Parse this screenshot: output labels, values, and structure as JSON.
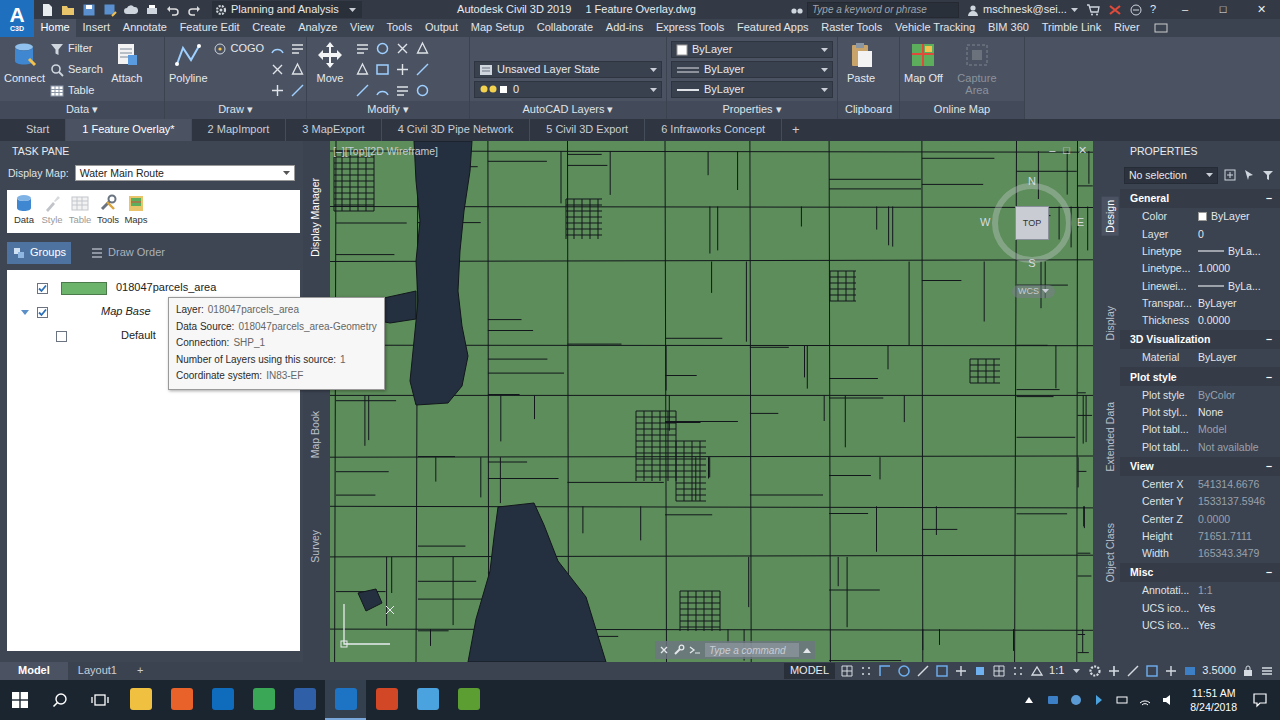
{
  "window": {
    "logo": "A",
    "logo_sub": "C3D",
    "workspace": "Planning and Analysis",
    "title": "Autodesk Civil 3D 2019",
    "file": "1 Feature Overlay.dwg",
    "search_placeholder": "Type a keyword or phrase",
    "user": "mschnesk@sei...",
    "help": "?",
    "controls": [
      "–",
      "□",
      "✕"
    ]
  },
  "ribbon_tabs": [
    {
      "label": "Home",
      "selected": true
    },
    {
      "label": "Insert",
      "selected": false
    },
    {
      "label": "Annotate",
      "selected": false
    },
    {
      "label": "Feature Edit",
      "selected": false
    },
    {
      "label": "Create",
      "selected": false
    },
    {
      "label": "Analyze",
      "selected": false
    },
    {
      "label": "View",
      "selected": false
    },
    {
      "label": "Tools",
      "selected": false
    },
    {
      "label": "Output",
      "selected": false
    },
    {
      "label": "Map Setup",
      "selected": false
    },
    {
      "label": "Collaborate",
      "selected": false
    },
    {
      "label": "Add-ins",
      "selected": false
    },
    {
      "label": "Express Tools",
      "selected": false
    },
    {
      "label": "Featured Apps",
      "selected": false
    },
    {
      "label": "Raster Tools",
      "selected": false
    },
    {
      "label": "Vehicle Tracking",
      "selected": false
    },
    {
      "label": "BIM 360",
      "selected": false
    },
    {
      "label": "Trimble Link",
      "selected": false
    },
    {
      "label": "River",
      "selected": false
    }
  ],
  "ribbon_groups": [
    {
      "title": "Data",
      "arrow": "▾",
      "items": [
        {
          "kind": "large",
          "label": "Connect",
          "disabled": false
        },
        {
          "kind": "small",
          "label": "Filter",
          "disabled": false
        },
        {
          "kind": "small",
          "label": "Search",
          "disabled": false
        },
        {
          "kind": "small",
          "label": "Table",
          "disabled": false
        },
        {
          "kind": "large",
          "label": "Attach",
          "disabled": false
        }
      ]
    },
    {
      "title": "Draw",
      "arrow": "▾",
      "items": [
        {
          "kind": "large",
          "label": "Polyline",
          "disabled": false
        },
        {
          "kind": "small",
          "label": "COGO",
          "disabled": false
        }
      ]
    },
    {
      "title": "Modify",
      "arrow": "▾",
      "items": [
        {
          "kind": "large",
          "label": "Move",
          "disabled": false
        }
      ]
    },
    {
      "title": "AutoCAD Layers",
      "arrow": "▾",
      "items": [
        {
          "kind": "dropdown",
          "label": "Unsaved Layer State",
          "disabled": false
        },
        {
          "kind": "dropdown",
          "label": "0",
          "disabled": false
        }
      ]
    },
    {
      "title": "Properties",
      "arrow": "▾",
      "items": [
        {
          "kind": "dropdown",
          "label": "ByLayer",
          "disabled": false
        },
        {
          "kind": "dropdown",
          "label": "ByLayer",
          "disabled": false
        },
        {
          "kind": "dropdown",
          "label": "ByLayer",
          "disabled": false
        }
      ]
    },
    {
      "title": "Clipboard",
      "items": [
        {
          "kind": "large",
          "label": "Paste",
          "disabled": false
        }
      ]
    },
    {
      "title": "Online Map",
      "items": [
        {
          "kind": "large",
          "label": "Map Off",
          "disabled": false
        },
        {
          "kind": "large",
          "label": "Capture Area",
          "disabled": true
        }
      ]
    }
  ],
  "doc_tabs": [
    {
      "label": "Start",
      "selected": false
    },
    {
      "label": "1 Feature Overlay*",
      "selected": true
    },
    {
      "label": "2 MapImport",
      "selected": false
    },
    {
      "label": "3 MapExport",
      "selected": false
    },
    {
      "label": "4 Civil 3D Pipe Network",
      "selected": false
    },
    {
      "label": "5 Civil 3D Export",
      "selected": false
    },
    {
      "label": "6 Infraworks Concept",
      "selected": false
    }
  ],
  "doc_tab_add": "+",
  "task_pane": {
    "title": "TASK PANE",
    "display_map_label": "Display Map:",
    "display_map": "Water Main Route",
    "tools": [
      {
        "label": "Data",
        "disabled": false
      },
      {
        "label": "Style",
        "disabled": true
      },
      {
        "label": "Table",
        "disabled": true
      },
      {
        "label": "Tools",
        "disabled": false
      },
      {
        "label": "Maps",
        "disabled": false
      }
    ],
    "views": [
      {
        "label": "Groups",
        "selected": true
      },
      {
        "label": "Draw Order",
        "selected": false
      }
    ],
    "layers": [
      {
        "kind": "layer",
        "label": "018047parcels_area",
        "checked": true,
        "color": "#6cb46c"
      },
      {
        "kind": "group",
        "label": "Map Base",
        "checked": true,
        "expanded": true
      },
      {
        "kind": "child",
        "label": "Default",
        "checked": false
      }
    ]
  },
  "task_side_tabs": [
    {
      "label": "Display Manager",
      "selected": true
    },
    {
      "label": "Map Book",
      "selected": false
    },
    {
      "label": "Survey",
      "selected": false
    }
  ],
  "tooltip": {
    "rows": [
      {
        "key": "Layer:",
        "value": "018047parcels_area"
      },
      {
        "key": "Data Source:",
        "value": "018047parcels_area-Geometry"
      },
      {
        "key": "Connection:",
        "value": "SHP_1"
      },
      {
        "key": "Number of Layers using this source:",
        "value": "1"
      },
      {
        "key": "Coordinate system:",
        "value": "IN83-EF"
      }
    ]
  },
  "viewport": {
    "label": "[–][Top][2D Wireframe]",
    "controls": [
      "–",
      "□",
      "✕"
    ],
    "compass": {
      "north": "N",
      "south": "S",
      "east": "E",
      "west": "W",
      "face": "TOP",
      "ucs": "WCS"
    },
    "command_placeholder": "Type a command"
  },
  "properties": {
    "title": "PROPERTIES",
    "selection": "No selection",
    "side_tabs": [
      {
        "label": "Design",
        "selected": true
      },
      {
        "label": "Display",
        "selected": false
      },
      {
        "label": "Extended Data",
        "selected": false
      },
      {
        "label": "Object Class",
        "selected": false
      }
    ],
    "sections": [
      {
        "title": "General",
        "toggle": "−",
        "expanded": true,
        "rows": [
          {
            "key": "Color",
            "value": "ByLayer",
            "kind": "swatch",
            "disabled": false
          },
          {
            "key": "Layer",
            "value": "0",
            "kind": "text",
            "disabled": false
          },
          {
            "key": "Linetype",
            "value": "ByLa...",
            "kind": "line",
            "disabled": false
          },
          {
            "key": "Linetype...",
            "value": "1.0000",
            "kind": "text",
            "disabled": false
          },
          {
            "key": "Linewei...",
            "value": "ByLa...",
            "kind": "line",
            "disabled": false
          },
          {
            "key": "Transpar...",
            "value": "ByLayer",
            "kind": "text",
            "disabled": false
          },
          {
            "key": "Thickness",
            "value": "0.0000",
            "kind": "text",
            "disabled": false
          }
        ]
      },
      {
        "title": "3D Visualization",
        "toggle": "−",
        "expanded": true,
        "rows": [
          {
            "key": "Material",
            "value": "ByLayer",
            "kind": "text",
            "disabled": false
          }
        ]
      },
      {
        "title": "Plot style",
        "toggle": "−",
        "expanded": true,
        "rows": [
          {
            "key": "Plot style",
            "value": "ByColor",
            "kind": "text",
            "disabled": true
          },
          {
            "key": "Plot styl...",
            "value": "None",
            "kind": "text",
            "disabled": false
          },
          {
            "key": "Plot tabl...",
            "value": "Model",
            "kind": "text",
            "disabled": true
          },
          {
            "key": "Plot tabl...",
            "value": "Not available",
            "kind": "text",
            "disabled": true
          }
        ]
      },
      {
        "title": "View",
        "toggle": "−",
        "expanded": true,
        "rows": [
          {
            "key": "Center X",
            "value": "541314.6676",
            "kind": "text",
            "disabled": true
          },
          {
            "key": "Center Y",
            "value": "1533137.5946",
            "kind": "text",
            "disabled": true
          },
          {
            "key": "Center Z",
            "value": "0.0000",
            "kind": "text",
            "disabled": true
          },
          {
            "key": "Height",
            "value": "71651.7111",
            "kind": "text",
            "disabled": true
          },
          {
            "key": "Width",
            "value": "165343.3479",
            "kind": "text",
            "disabled": true
          }
        ]
      },
      {
        "title": "Misc",
        "toggle": "−",
        "expanded": true,
        "rows": [
          {
            "key": "Annotati...",
            "value": "1:1",
            "kind": "text",
            "disabled": true
          },
          {
            "key": "UCS ico...",
            "value": "Yes",
            "kind": "text",
            "disabled": false
          },
          {
            "key": "UCS ico...",
            "value": "Yes",
            "kind": "text",
            "disabled": false
          }
        ]
      }
    ]
  },
  "layout_tabs": [
    {
      "label": "Model",
      "selected": true
    },
    {
      "label": "Layout1",
      "selected": false
    }
  ],
  "layout_add": "+",
  "status": {
    "model": "MODEL",
    "scale": "1:1",
    "annotation_scale": "3.5000"
  },
  "taskbar": {
    "apps": [
      {
        "color": "#f0c040",
        "selected": false
      },
      {
        "color": "#e8622a",
        "selected": false
      },
      {
        "color": "#0f6cbd",
        "selected": false
      },
      {
        "color": "#3aa757",
        "selected": false
      },
      {
        "color": "#2f5fa7",
        "selected": false
      },
      {
        "color": "#1d74c4",
        "selected": true
      },
      {
        "color": "#d24726",
        "selected": false
      },
      {
        "color": "#4aa3df",
        "selected": false
      },
      {
        "color": "#5c9e31",
        "selected": false
      }
    ],
    "time": "11:51 AM",
    "date": "8/24/2018"
  }
}
